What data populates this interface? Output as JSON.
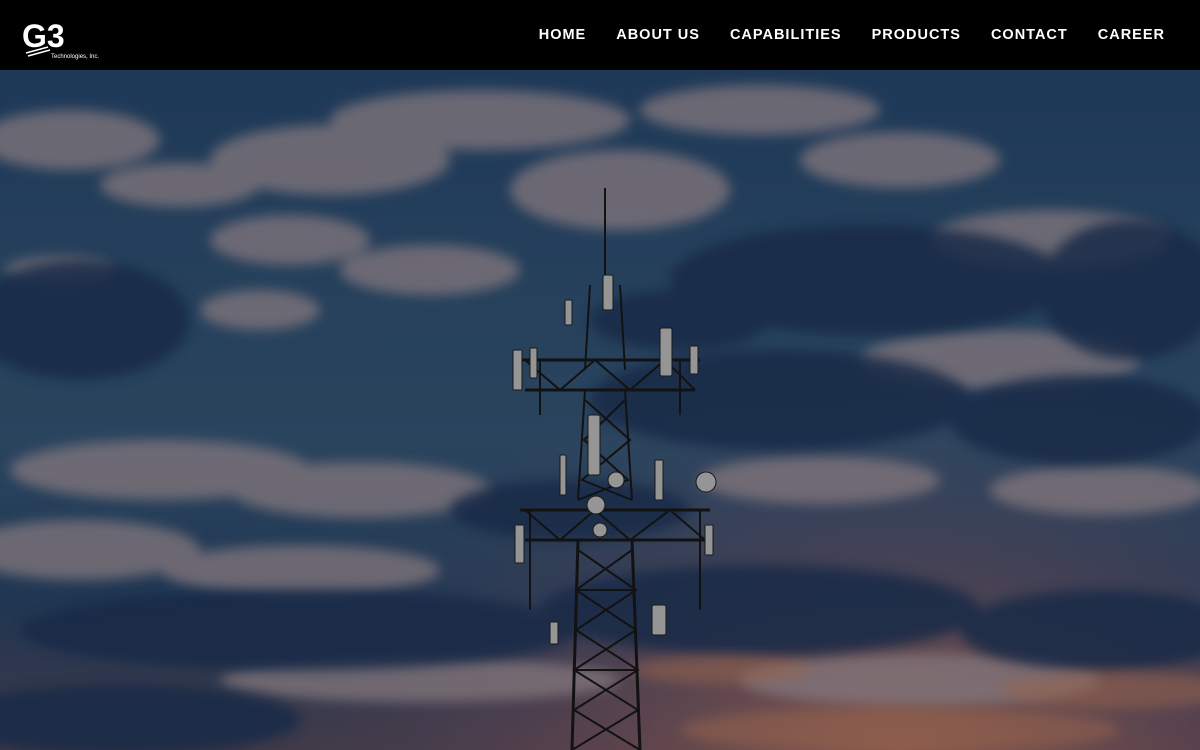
{
  "brand": {
    "logo_text": "G3",
    "logo_subtitle": "Technologies, Inc."
  },
  "nav": {
    "items": [
      {
        "label": "HOME"
      },
      {
        "label": "ABOUT US"
      },
      {
        "label": "CAPABILITIES"
      },
      {
        "label": "PRODUCTS"
      },
      {
        "label": "CONTACT"
      },
      {
        "label": "CAREER"
      }
    ]
  },
  "hero": {
    "image": "cell-tower-at-dusk",
    "colors": {
      "sky": "#34597f",
      "cloud_light": "#b8a8b0",
      "cloud_dark": "#233a5e",
      "sunset": "#c98a6a",
      "tower": "#1a1a1a"
    }
  }
}
